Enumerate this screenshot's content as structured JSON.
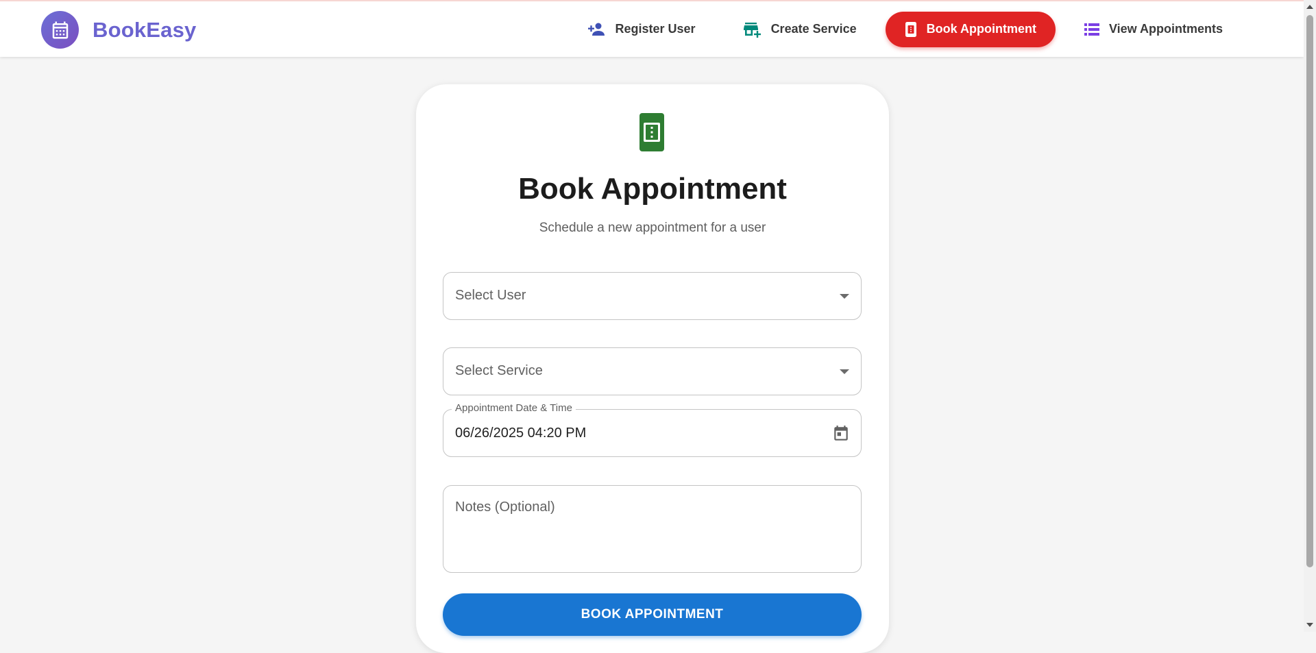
{
  "app": {
    "brand_name": "BookEasy",
    "brand_icon": "calendar-icon"
  },
  "nav": {
    "items": [
      {
        "label": "Register User",
        "icon": "person-add-icon",
        "active": false
      },
      {
        "label": "Create Service",
        "icon": "add-business-icon",
        "active": false
      },
      {
        "label": "Book Appointment",
        "icon": "ticket-icon",
        "active": true
      },
      {
        "label": "View Appointments",
        "icon": "list-icon",
        "active": false
      }
    ]
  },
  "form": {
    "icon": "ticket-icon",
    "title": "Book Appointment",
    "subtitle": "Schedule a new appointment for a user",
    "user_select": {
      "placeholder": "Select User"
    },
    "service_select": {
      "placeholder": "Select Service"
    },
    "datetime": {
      "label": "Appointment Date & Time",
      "value": "06/26/2025 04:20 PM"
    },
    "notes": {
      "placeholder": "Notes (Optional)",
      "value": ""
    },
    "submit_label": "BOOK APPOINTMENT"
  },
  "colors": {
    "brand": "#6a63cf",
    "active_nav": "#e02424",
    "primary_button": "#1976d2",
    "form_icon": "#2e7d32",
    "register_icon": "#3f51b5",
    "service_icon": "#00897b",
    "appointments_icon": "#7b3fe4"
  }
}
